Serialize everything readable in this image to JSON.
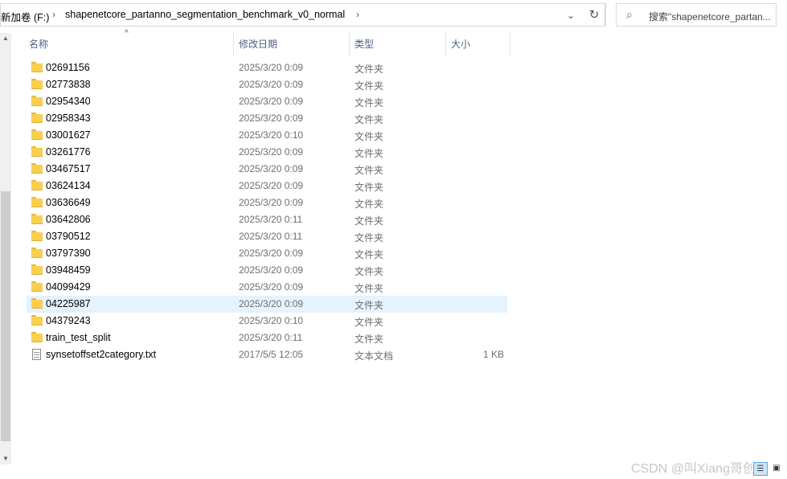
{
  "address": {
    "drive": "新加卷 (F:)",
    "folder": "shapenetcore_partanno_segmentation_benchmark_v0_normal"
  },
  "search": {
    "placeholder": "搜索\"shapenetcore_partan..."
  },
  "columns": {
    "name": "名称",
    "date": "修改日期",
    "type": "类型",
    "size": "大小"
  },
  "files": [
    {
      "name": "02691156",
      "date": "2025/3/20 0:09",
      "type": "文件夹",
      "size": "",
      "kind": "folder"
    },
    {
      "name": "02773838",
      "date": "2025/3/20 0:09",
      "type": "文件夹",
      "size": "",
      "kind": "folder"
    },
    {
      "name": "02954340",
      "date": "2025/3/20 0:09",
      "type": "文件夹",
      "size": "",
      "kind": "folder"
    },
    {
      "name": "02958343",
      "date": "2025/3/20 0:09",
      "type": "文件夹",
      "size": "",
      "kind": "folder"
    },
    {
      "name": "03001627",
      "date": "2025/3/20 0:10",
      "type": "文件夹",
      "size": "",
      "kind": "folder"
    },
    {
      "name": "03261776",
      "date": "2025/3/20 0:09",
      "type": "文件夹",
      "size": "",
      "kind": "folder"
    },
    {
      "name": "03467517",
      "date": "2025/3/20 0:09",
      "type": "文件夹",
      "size": "",
      "kind": "folder"
    },
    {
      "name": "03624134",
      "date": "2025/3/20 0:09",
      "type": "文件夹",
      "size": "",
      "kind": "folder"
    },
    {
      "name": "03636649",
      "date": "2025/3/20 0:09",
      "type": "文件夹",
      "size": "",
      "kind": "folder"
    },
    {
      "name": "03642806",
      "date": "2025/3/20 0:11",
      "type": "文件夹",
      "size": "",
      "kind": "folder"
    },
    {
      "name": "03790512",
      "date": "2025/3/20 0:11",
      "type": "文件夹",
      "size": "",
      "kind": "folder"
    },
    {
      "name": "03797390",
      "date": "2025/3/20 0:09",
      "type": "文件夹",
      "size": "",
      "kind": "folder"
    },
    {
      "name": "03948459",
      "date": "2025/3/20 0:09",
      "type": "文件夹",
      "size": "",
      "kind": "folder"
    },
    {
      "name": "04099429",
      "date": "2025/3/20 0:09",
      "type": "文件夹",
      "size": "",
      "kind": "folder"
    },
    {
      "name": "04225987",
      "date": "2025/3/20 0:09",
      "type": "文件夹",
      "size": "",
      "kind": "folder",
      "selected": true
    },
    {
      "name": "04379243",
      "date": "2025/3/20 0:10",
      "type": "文件夹",
      "size": "",
      "kind": "folder"
    },
    {
      "name": "train_test_split",
      "date": "2025/3/20 0:11",
      "type": "文件夹",
      "size": "",
      "kind": "folder"
    },
    {
      "name": "synsetoffset2category.txt",
      "date": "2017/5/5 12:05",
      "type": "文本文档",
      "size": "1 KB",
      "kind": "text-file"
    }
  ],
  "watermark": "CSDN @叫Xiang哥创行"
}
